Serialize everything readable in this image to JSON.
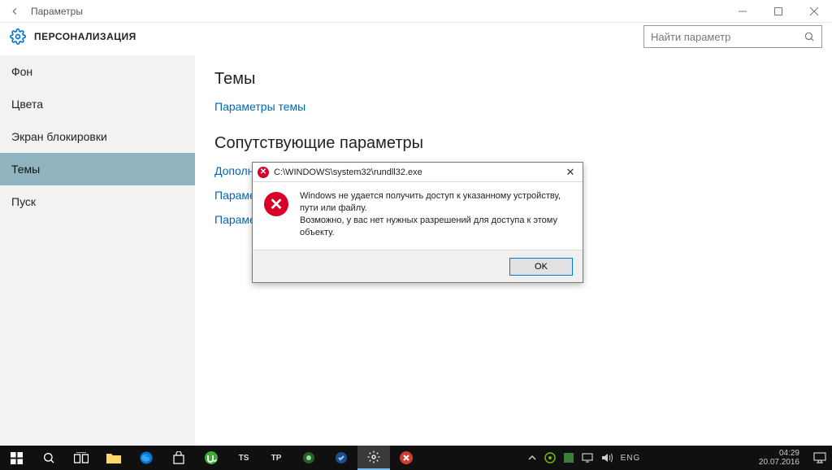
{
  "window": {
    "title": "Параметры",
    "section": "ПЕРСОНАЛИЗАЦИЯ",
    "search_placeholder": "Найти параметр"
  },
  "sidebar": {
    "items": [
      "Фон",
      "Цвета",
      "Экран блокировки",
      "Темы",
      "Пуск"
    ],
    "selected_index": 3
  },
  "content": {
    "heading1": "Темы",
    "link1": "Параметры темы",
    "heading2": "Сопутствующие параметры",
    "link2_trunc": "Дополн",
    "link3_trunc": "Параме",
    "link4_trunc": "Параме"
  },
  "dialog": {
    "title": "C:\\WINDOWS\\system32\\rundll32.exe",
    "message_line1": "Windows не удается получить доступ к указанному устройству, пути или файлу.",
    "message_line2": "Возможно, у вас нет нужных разрешений для доступа к этому объекту.",
    "ok_label": "OK"
  },
  "taskbar": {
    "lang": "ENG",
    "time": "04:29",
    "date": "20.07.2016",
    "labels": {
      "ts": "TS",
      "tp": "TP"
    }
  }
}
